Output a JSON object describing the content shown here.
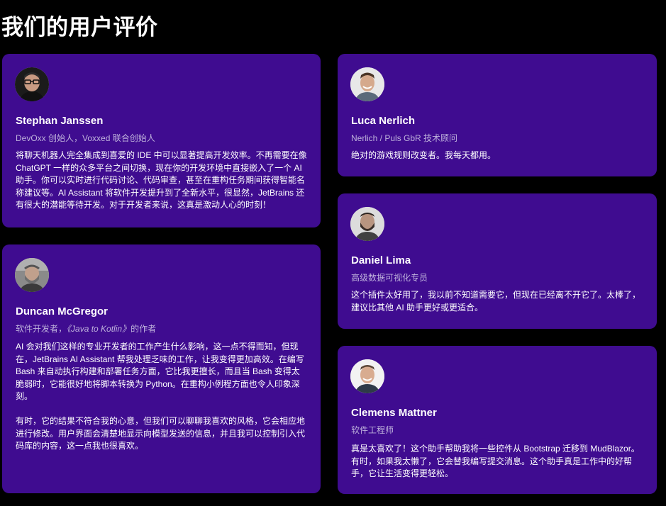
{
  "heading": "我们的用户评价",
  "colors": {
    "card_bg": "#3f0c90",
    "page_bg": "#000000",
    "role_text": "#bfb2dc"
  },
  "testimonials": [
    {
      "name": "Stephan Janssen",
      "role": "DevOxx 创始人，Voxxed 联合创始人",
      "quote": "将聊天机器人完全集成到喜爱的 IDE 中可以显著提高开发效率。不再需要在像 ChatGPT 一样的众多平台之间切换，现在你的开发环境中直接嵌入了一个 AI 助手。你可以实时进行代码讨论、代码审查，甚至在重构任务期间获得智能名称建议等。AI Assistant 将软件开发提升到了全新水平，很显然，JetBrains 还有很大的潜能等待开发。对于开发者来说，这真是激动人心的时刻！",
      "avatar_icon": "avatar-glasses-man"
    },
    {
      "name": "Luca Nerlich",
      "role": "Nerlich / Puls GbR 技术顾问",
      "quote": "绝对的游戏规则改变者。我每天都用。",
      "avatar_icon": "avatar-smiling-man"
    },
    {
      "name": "Duncan McGregor",
      "role_prefix": "软件开发者，",
      "role_book": "《Java to Kotlin》",
      "role_suffix": "的作者",
      "quote_p1": "AI 会对我们这样的专业开发者的工作产生什么影响，这一点不得而知，但现在，JetBrains AI Assistant 帮我处理乏味的工作，让我变得更加高效。在编写 Bash 来自动执行构建和部署任务方面，它比我更擅长，而且当 Bash 变得太脆弱时，它能很好地将脚本转换为 Python。在重构小例程方面也令人印象深刻。",
      "quote_p2": "有时，它的结果不符合我的心意，但我们可以聊聊我喜欢的风格，它会相应地进行修改。用户界面会清楚地显示向模型发送的信息，并且我可以控制引入代码库的内容，这一点我也很喜欢。",
      "avatar_icon": "avatar-bearded-man"
    },
    {
      "name": "Daniel Lima",
      "role": "高级数据可视化专员",
      "quote": "这个插件太好用了，我以前不知道需要它，但现在已经离不开它了。太棒了，建议比其他 AI 助手更好或更适合。",
      "avatar_icon": "avatar-bearded-man-2"
    },
    {
      "name": "Clemens Mattner",
      "role": "软件工程师",
      "quote": "真是太喜欢了！这个助手帮助我将一些控件从 Bootstrap 迁移到 MudBlazor。有时，如果我太懒了，它会替我编写提交消息。这个助手真是工作中的好帮手，它让生活变得更轻松。",
      "avatar_icon": "avatar-smiling-man-2"
    }
  ]
}
